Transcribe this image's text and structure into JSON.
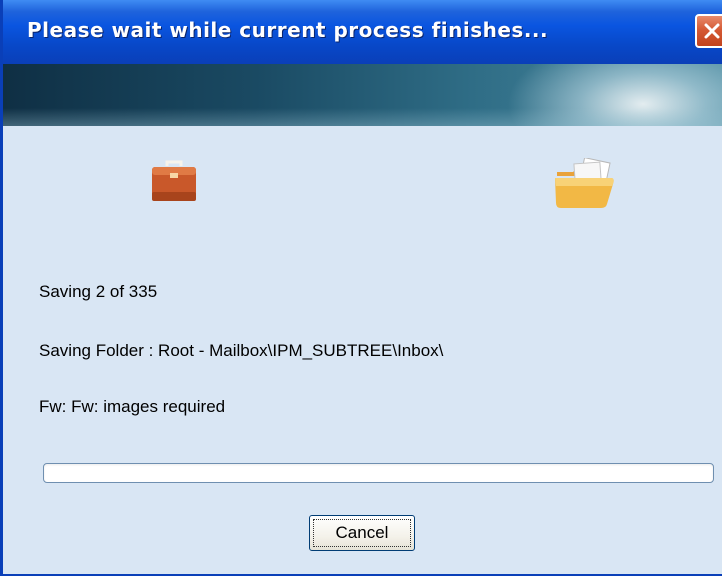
{
  "window": {
    "title": "Please wait while current process finishes..."
  },
  "icons": {
    "source": "briefcase-icon",
    "destination": "folder-icon",
    "close": "close-icon"
  },
  "status": {
    "count": "Saving 2 of 335",
    "folder": "Saving Folder : Root - Mailbox\\IPM_SUBTREE\\Inbox\\",
    "item": "Fw: Fw: images required"
  },
  "progress": {
    "fraction": 0.0
  },
  "buttons": {
    "cancel": "Cancel"
  },
  "colors": {
    "titlebar": "#0a55e0",
    "close": "#d55a35",
    "body": "#d9e6f4",
    "progress_fill": "#3fbf3f"
  }
}
